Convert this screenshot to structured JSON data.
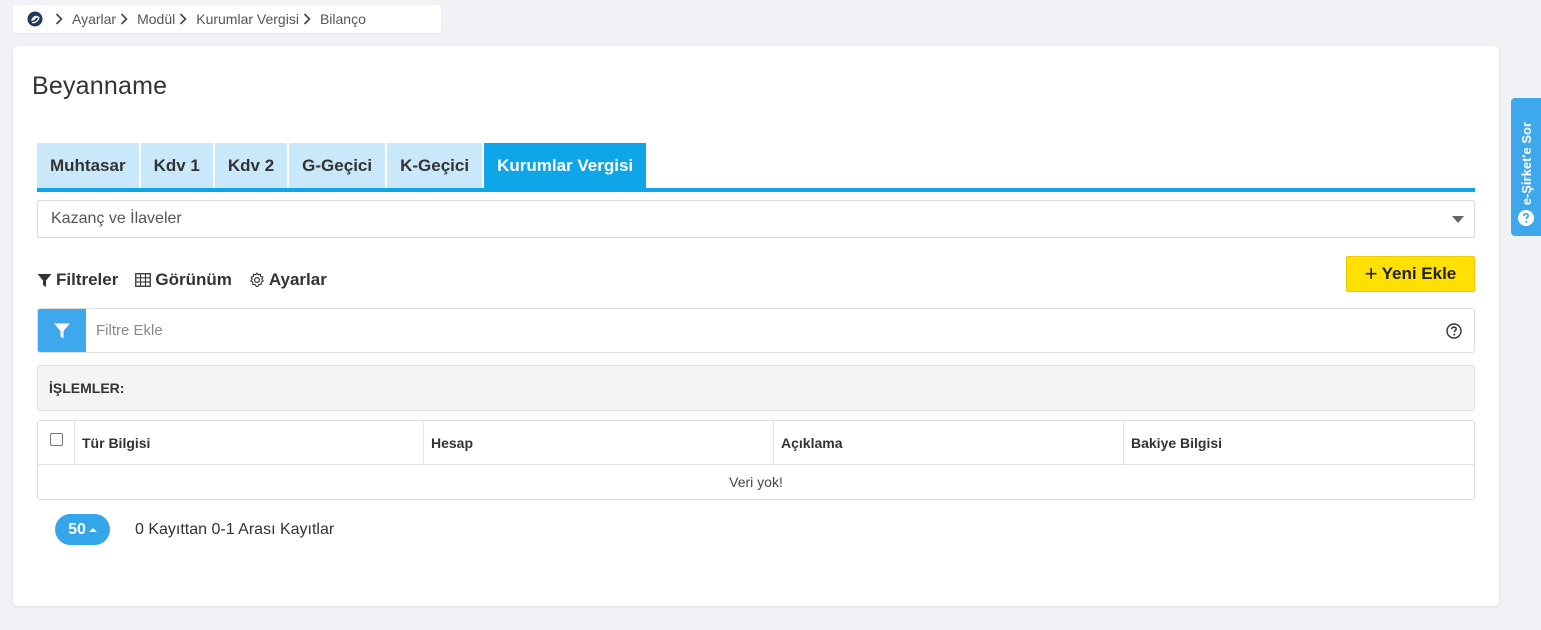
{
  "breadcrumb": {
    "home_icon": "home-logo-icon",
    "items": [
      "Ayarlar",
      "Modül",
      "Kurumlar Vergisi",
      "Bilanço"
    ]
  },
  "page": {
    "title": "Beyanname"
  },
  "tabs": [
    {
      "label": "Muhtasar",
      "active": false
    },
    {
      "label": "Kdv 1",
      "active": false
    },
    {
      "label": "Kdv 2",
      "active": false
    },
    {
      "label": "G-Geçici",
      "active": false
    },
    {
      "label": "K-Geçici",
      "active": false
    },
    {
      "label": "Kurumlar Vergisi",
      "active": true
    }
  ],
  "category_select": {
    "value": "Kazanç ve İlaveler"
  },
  "toolbar": {
    "filters_label": "Filtreler",
    "view_label": "Görünüm",
    "settings_label": "Ayarlar",
    "add_label": "Yeni Ekle"
  },
  "filter": {
    "placeholder": "Filtre Ekle"
  },
  "operations": {
    "label": "İŞLEMLER:"
  },
  "table": {
    "columns": [
      "Tür Bilgisi",
      "Hesap",
      "Açıklama",
      "Bakiye Bilgisi"
    ],
    "empty_message": "Veri yok!"
  },
  "pager": {
    "page_size": "50",
    "summary": "0 Kayıttan 0-1 Arası Kayıtlar"
  },
  "side_tab": {
    "label": "e-Şirket'e Sor"
  },
  "colors": {
    "accent": "#0ea5e9",
    "tab_inactive": "#c9e9fb",
    "add_button": "#ffe000"
  }
}
